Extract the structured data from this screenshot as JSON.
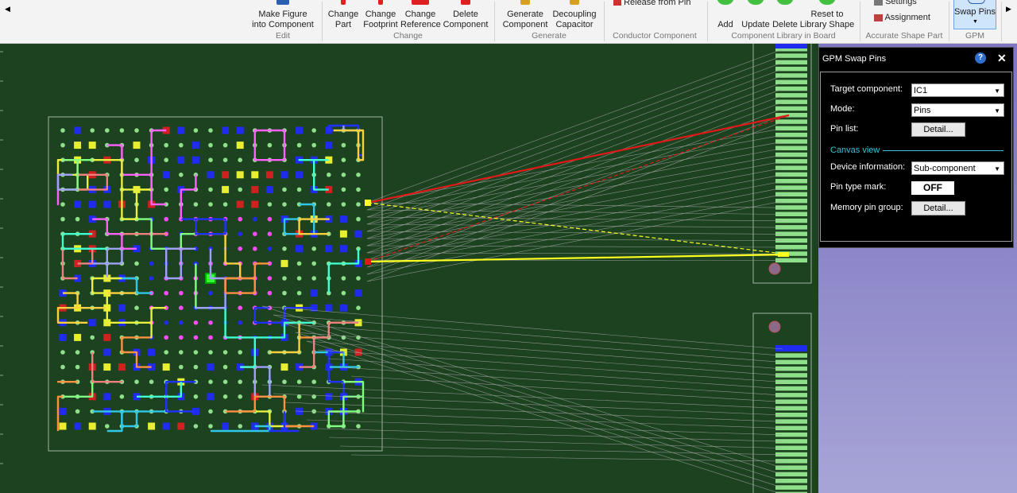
{
  "ribbon": {
    "buttons": [
      {
        "id": "make-figure",
        "line1": "Make Figure",
        "line2": "into Component"
      },
      {
        "id": "change-part",
        "line1": "Change",
        "line2": "Part"
      },
      {
        "id": "change-footprint",
        "line1": "Change",
        "line2": "Footprint"
      },
      {
        "id": "change-reference",
        "line1": "Change",
        "line2": "Reference"
      },
      {
        "id": "delete-component",
        "line1": "Delete",
        "line2": "Component"
      },
      {
        "id": "generate-component",
        "line1": "Generate",
        "line2": "Component"
      },
      {
        "id": "decoupling-capacitor",
        "line1": "Decoupling",
        "line2": "Capacitor"
      },
      {
        "id": "release-from-pin",
        "line1": "Release from Pin"
      },
      {
        "id": "add",
        "line1": "Add"
      },
      {
        "id": "update",
        "line1": "Update"
      },
      {
        "id": "delete",
        "line1": "Delete"
      },
      {
        "id": "reset-library",
        "line1": "Reset to",
        "line2": "Library Shape"
      },
      {
        "id": "settings",
        "line1": "Settings"
      },
      {
        "id": "assignment",
        "line1": "Assignment"
      },
      {
        "id": "swap-pins",
        "line1": "Swap Pins"
      }
    ],
    "groups": [
      "Edit",
      "Change",
      "Generate",
      "Conductor Component",
      "Component Library in Board",
      "Accurate Shape Part",
      "GPM"
    ]
  },
  "panel": {
    "title": "GPM Swap Pins",
    "help_icon": "?",
    "close_icon": "✕",
    "target_component_label": "Target component:",
    "target_component_value": "IC1",
    "mode_label": "Mode:",
    "mode_value": "Pins",
    "pin_list_label": "Pin list:",
    "pin_list_button": "Detail...",
    "canvas_view_label": "Canvas view",
    "device_info_label": "Device information:",
    "device_info_value": "Sub-component",
    "pin_type_mark_label": "Pin type mark:",
    "pin_type_mark_value": "OFF",
    "memory_pin_group_label": "Memory pin group:",
    "memory_pin_group_button": "Detail..."
  },
  "colors": {
    "board": "#1c4220",
    "pad_green": "#8fe08a",
    "pad_blue": "#1f2cf0",
    "pad_magenta": "#ff4cff",
    "ratsnest": "#a8a8a8",
    "highlight_red": "#e01818",
    "highlight_yellow": "#ffff20"
  }
}
